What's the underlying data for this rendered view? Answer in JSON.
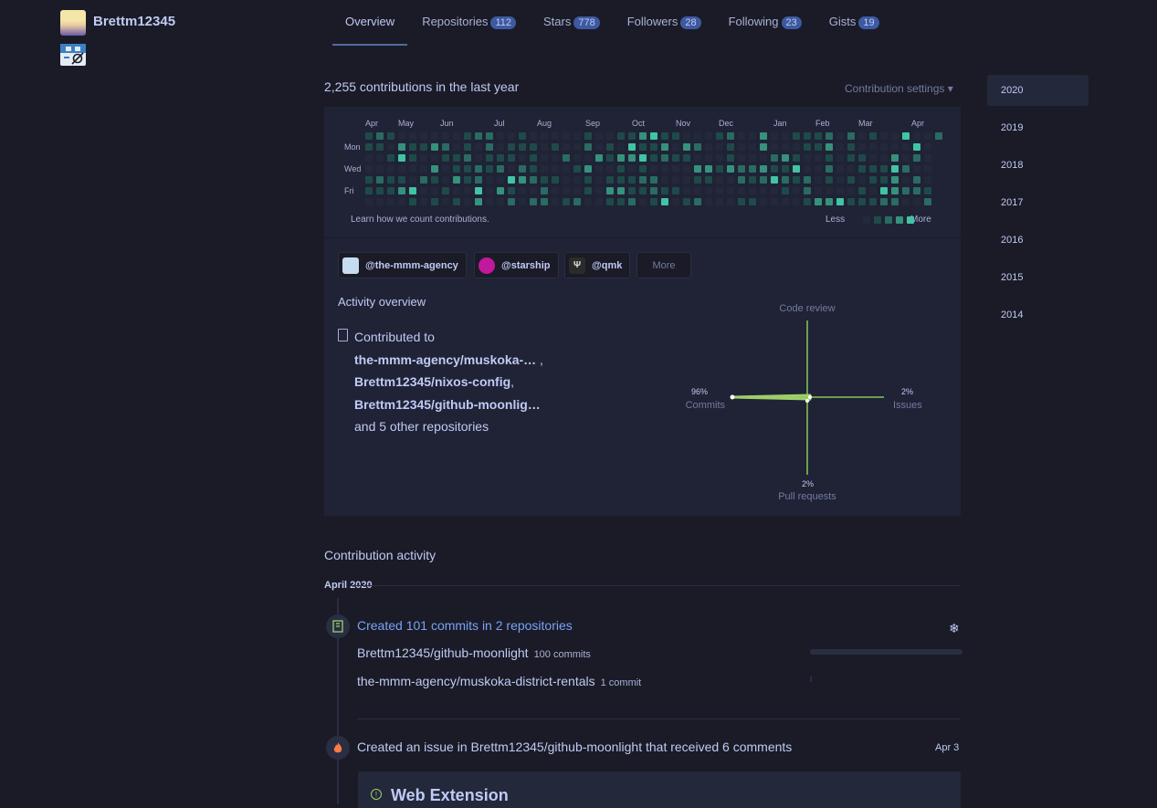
{
  "user": {
    "name": "Brettm12345"
  },
  "tabs": [
    {
      "label": "Overview",
      "count": null
    },
    {
      "label": "Repositories",
      "count": "112"
    },
    {
      "label": "Stars",
      "count": "778"
    },
    {
      "label": "Followers",
      "count": "28"
    },
    {
      "label": "Following",
      "count": "23"
    },
    {
      "label": "Gists",
      "count": "19"
    }
  ],
  "contributions": {
    "title": "2,255 contributions in the last year",
    "settings_label": "Contribution settings ▾",
    "months": [
      "Apr",
      "May",
      "Jun",
      "Jul",
      "Aug",
      "Sep",
      "Oct",
      "Nov",
      "Dec",
      "Jan",
      "Feb",
      "Mar",
      "Apr"
    ],
    "day_labels": [
      "Mon",
      "Wed",
      "Fri"
    ],
    "learn_link": "Learn how we count contributions.",
    "legend_less": "Less",
    "legend_more": "More",
    "colors": [
      "#24283b",
      "#1f4a4a",
      "#2a6b63",
      "#36917d",
      "#41c4a3"
    ]
  },
  "orgs": [
    {
      "label": "@the-mmm-agency",
      "color": "#c6dcf0"
    },
    {
      "label": "@starship",
      "color": "#c2189b"
    },
    {
      "label": "@qmk",
      "color": "#2b2b2b"
    }
  ],
  "orgs_more": "More",
  "activity": {
    "title": "Activity overview",
    "contributed_to": "Contributed to",
    "repos": [
      "the-mmm-agency/muskoka-…",
      "Brettm12345/nixos-config",
      "Brettm12345/github-moonlig…"
    ],
    "sep1": " ,",
    "sep2": ",",
    "others": "and 5 other repositories",
    "radar": {
      "code_review": "Code review",
      "commits_pct": "96%",
      "commits": "Commits",
      "issues_pct": "2%",
      "issues": "Issues",
      "prs_pct": "2%",
      "prs": "Pull requests"
    }
  },
  "contribution_activity": {
    "title": "Contribution activity",
    "month": "April 2020",
    "commits_event": {
      "title": "Created 101 commits in 2 repositories",
      "rows": [
        {
          "repo": "Brettm12345/github-moonlight",
          "count": "100 commits",
          "fraction": 1.0
        },
        {
          "repo": "the-mmm-agency/muskoka-district-rentals",
          "count": "1 commit",
          "fraction": 0.01
        }
      ]
    },
    "issue_event": {
      "prefix": "Created an issue in ",
      "repo": "Brettm12345/github-moonlight",
      "suffix": " that received 6 comments",
      "date": "Apr 3",
      "issue_title": "Web Extension"
    }
  },
  "years": [
    "2020",
    "2019",
    "2018",
    "2017",
    "2016",
    "2015",
    "2014"
  ]
}
